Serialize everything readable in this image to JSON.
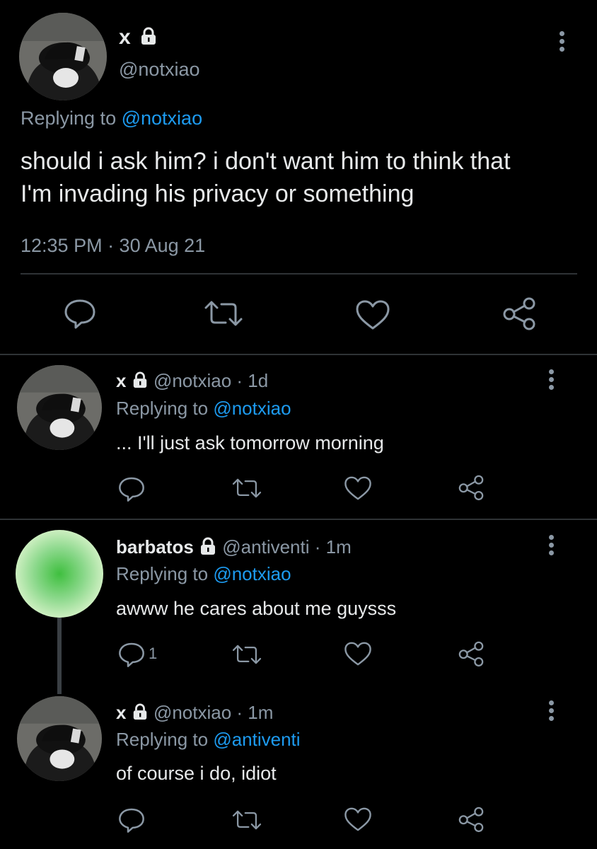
{
  "main_tweet": {
    "display_name": "x",
    "handle": "@notxiao",
    "replying_prefix": "Replying to",
    "replying_to": "@notxiao",
    "text_line1": "should i ask him? i don't want him to think that",
    "text_line2": "I'm invading his privacy or something",
    "timestamp": "12:35 PM · 30 Aug 21"
  },
  "replies": [
    {
      "display_name": "x",
      "handle": "@notxiao",
      "time": "· 1d",
      "replying_prefix": "Replying to",
      "replying_to": "@notxiao",
      "text": "... I'll just ask tomorrow morning",
      "reply_count": ""
    },
    {
      "display_name": "barbatos",
      "handle": "@antiventi",
      "time": "· 1m",
      "replying_prefix": "Replying to",
      "replying_to": "@notxiao",
      "text": "awww he cares about me guysss",
      "reply_count": "1"
    },
    {
      "display_name": "x",
      "handle": "@notxiao",
      "time": "· 1m",
      "replying_prefix": "Replying to",
      "replying_to": "@antiventi",
      "text": "of course i do, idiot",
      "reply_count": ""
    }
  ],
  "icons": [
    "lock-icon",
    "more-icon",
    "reply-icon",
    "retweet-icon",
    "like-icon",
    "share-icon"
  ],
  "colors": {
    "background": "#000000",
    "text": "#e7e9ea",
    "muted": "#8b98a5",
    "link": "#1d9bf0",
    "divider": "#2f3336",
    "thread_line": "#3a3f44"
  }
}
